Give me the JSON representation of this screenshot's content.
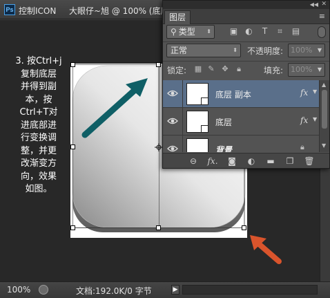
{
  "app": {
    "name": "控制ICON",
    "logo_text": "Ps",
    "document_tab": "大眼仔~旭 @ 100% (底层"
  },
  "instructions": {
    "lines": [
      "3. 按Ctrl+j",
      "复制底层",
      "并得到副",
      "本，按",
      "Ctrl+T对",
      "进底部进",
      "行变换调",
      "整，并更",
      "改渐变方",
      "向，效果",
      "如图。"
    ]
  },
  "status_bar": {
    "zoom": "100%",
    "doc_info": "文档:192.0K/0 字节"
  },
  "layers_panel": {
    "tab_label": "图层",
    "filter": {
      "label": "类型"
    },
    "blend_mode": "正常",
    "opacity_label": "不透明度:",
    "opacity_value": "100%",
    "lock_label": "锁定:",
    "fill_label": "填充:",
    "fill_value": "100%",
    "layers": [
      {
        "name": "底层 副本",
        "selected": true,
        "has_fx": true,
        "fx_label": "fx"
      },
      {
        "name": "底层",
        "selected": false,
        "has_fx": true,
        "fx_label": "fx"
      },
      {
        "name": "背景",
        "selected": false,
        "locked": true
      }
    ]
  },
  "colors": {
    "teal_arrow": "#0f5f66",
    "orange_arrow": "#d9542c",
    "selected_layer": "#5a6f8a",
    "panel_bg": "#535353",
    "canvas_bg": "#282828"
  },
  "icons": [
    "photoshop-logo-icon",
    "collapse-panel-icon",
    "close-panel-icon",
    "panel-menu-icon",
    "search-icon",
    "image-filter-icon",
    "adjustment-filter-icon",
    "text-filter-icon",
    "shape-filter-icon",
    "smart-object-filter-icon",
    "lock-transparent-icon",
    "lock-image-icon",
    "lock-position-icon",
    "lock-all-icon",
    "eye-icon",
    "link-layers-icon",
    "fx-icon",
    "layer-mask-icon",
    "adjustment-layer-icon",
    "group-icon",
    "new-layer-icon",
    "delete-icon",
    "crosshair-icon"
  ]
}
